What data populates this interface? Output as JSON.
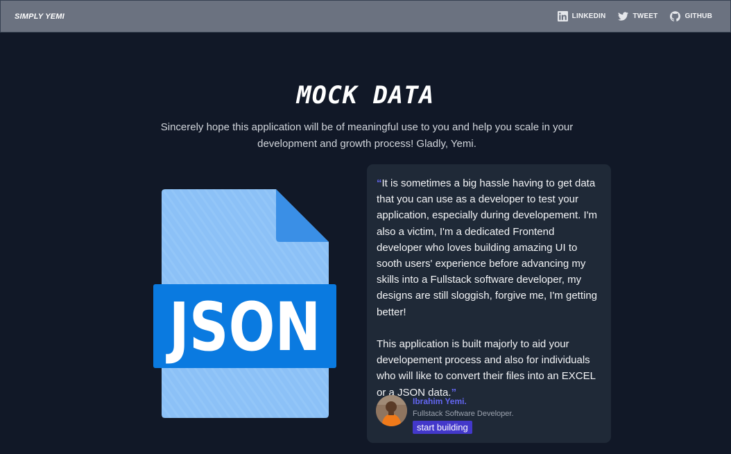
{
  "nav": {
    "brand": "SIMPLY YEMI",
    "links": [
      {
        "label": "LINKEDIN",
        "icon": "linkedin-icon"
      },
      {
        "label": "TWEET",
        "icon": "twitter-icon"
      },
      {
        "label": "GITHUB",
        "icon": "github-icon"
      }
    ]
  },
  "hero": {
    "title": "MOCK DATA",
    "subtitle": "Sincerely hope this application will be of meaningful use to you and help you scale in your development and growth process! Gladly, Yemi."
  },
  "illustration": {
    "label": "JSON"
  },
  "testimonial": {
    "open_quote": "“",
    "close_quote": "”",
    "paragraph1": "It is sometimes a big hassle having to get data that you can use as a developer to test your application, especially during developement. I'm also a victim, I'm a dedicated Frontend developer who loves building amazing UI to sooth users' experience before advancing my skills into a Fullstack software developer, my designs are still sloggish, forgive me, I'm getting better!",
    "paragraph2": "This application is built majorly to aid your developement process and also for individuals who will like to convert their files into an EXCEL or a JSON data.",
    "author_name": "Ibrahim Yemi.",
    "author_role": "Fullstack Software Developer.",
    "cta_label": "start building"
  },
  "colors": {
    "background": "#111827",
    "navbar": "#6b7280",
    "card": "#1f2937",
    "accent": "#6366f1",
    "button": "#4338ca",
    "json_blue": "#0a7ae0",
    "file_light": "#8cc1f7",
    "file_fold": "#3a8fe6"
  }
}
